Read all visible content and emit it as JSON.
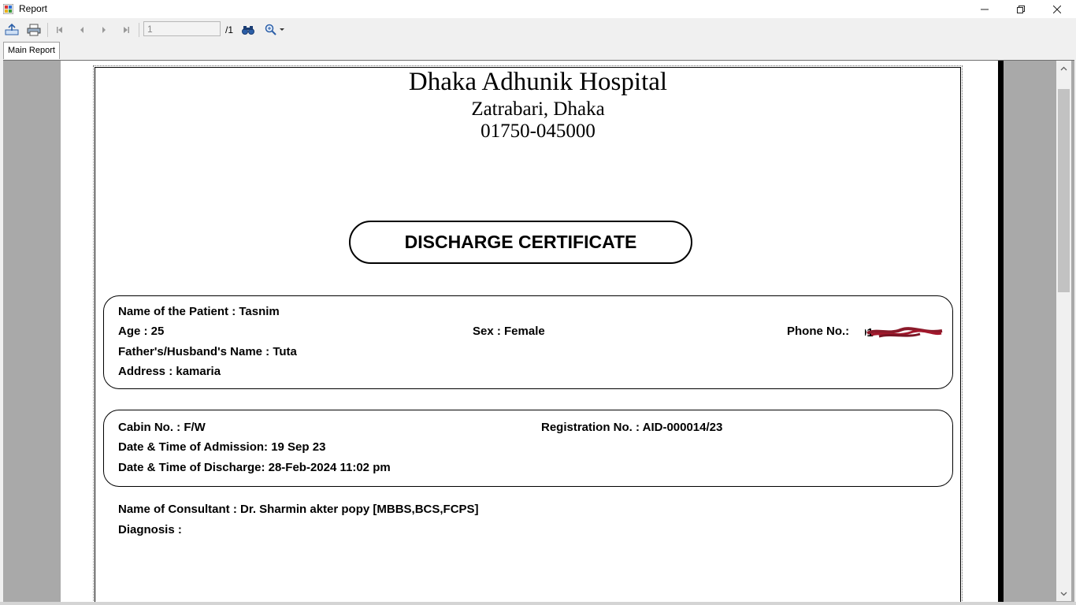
{
  "window": {
    "title": "Report"
  },
  "toolbar": {
    "page_input_value": "1",
    "page_total": "/1"
  },
  "tabs": [
    {
      "label": "Main Report"
    }
  ],
  "report": {
    "hospital_name": "Dhaka Adhunik Hospital",
    "hospital_location": "Zatrabari, Dhaka",
    "hospital_phone": "01750-045000",
    "certificate_title": "DISCHARGE CERTIFICATE",
    "patient": {
      "name": "Name of the Patient :  Tasnim",
      "age": "Age :  25",
      "sex": "Sex :  Female",
      "phone_label": "Phone No.:",
      "guardian": "Father's/Husband's Name :  Tuta",
      "address": "Address :  kamaria"
    },
    "admission": {
      "cabin": "Cabin No. :  F/W",
      "registration": "Registration No. :  AID-000014/23",
      "admission_time": "Date & Time of Admission:  19 Sep 23",
      "discharge_time": "Date & Time of Discharge:  28-Feb-2024  11:02 pm"
    },
    "consultant": "Name of Consultant :   Dr. Sharmin akter popy [MBBS,BCS,FCPS]",
    "diagnosis": "Diagnosis :"
  }
}
